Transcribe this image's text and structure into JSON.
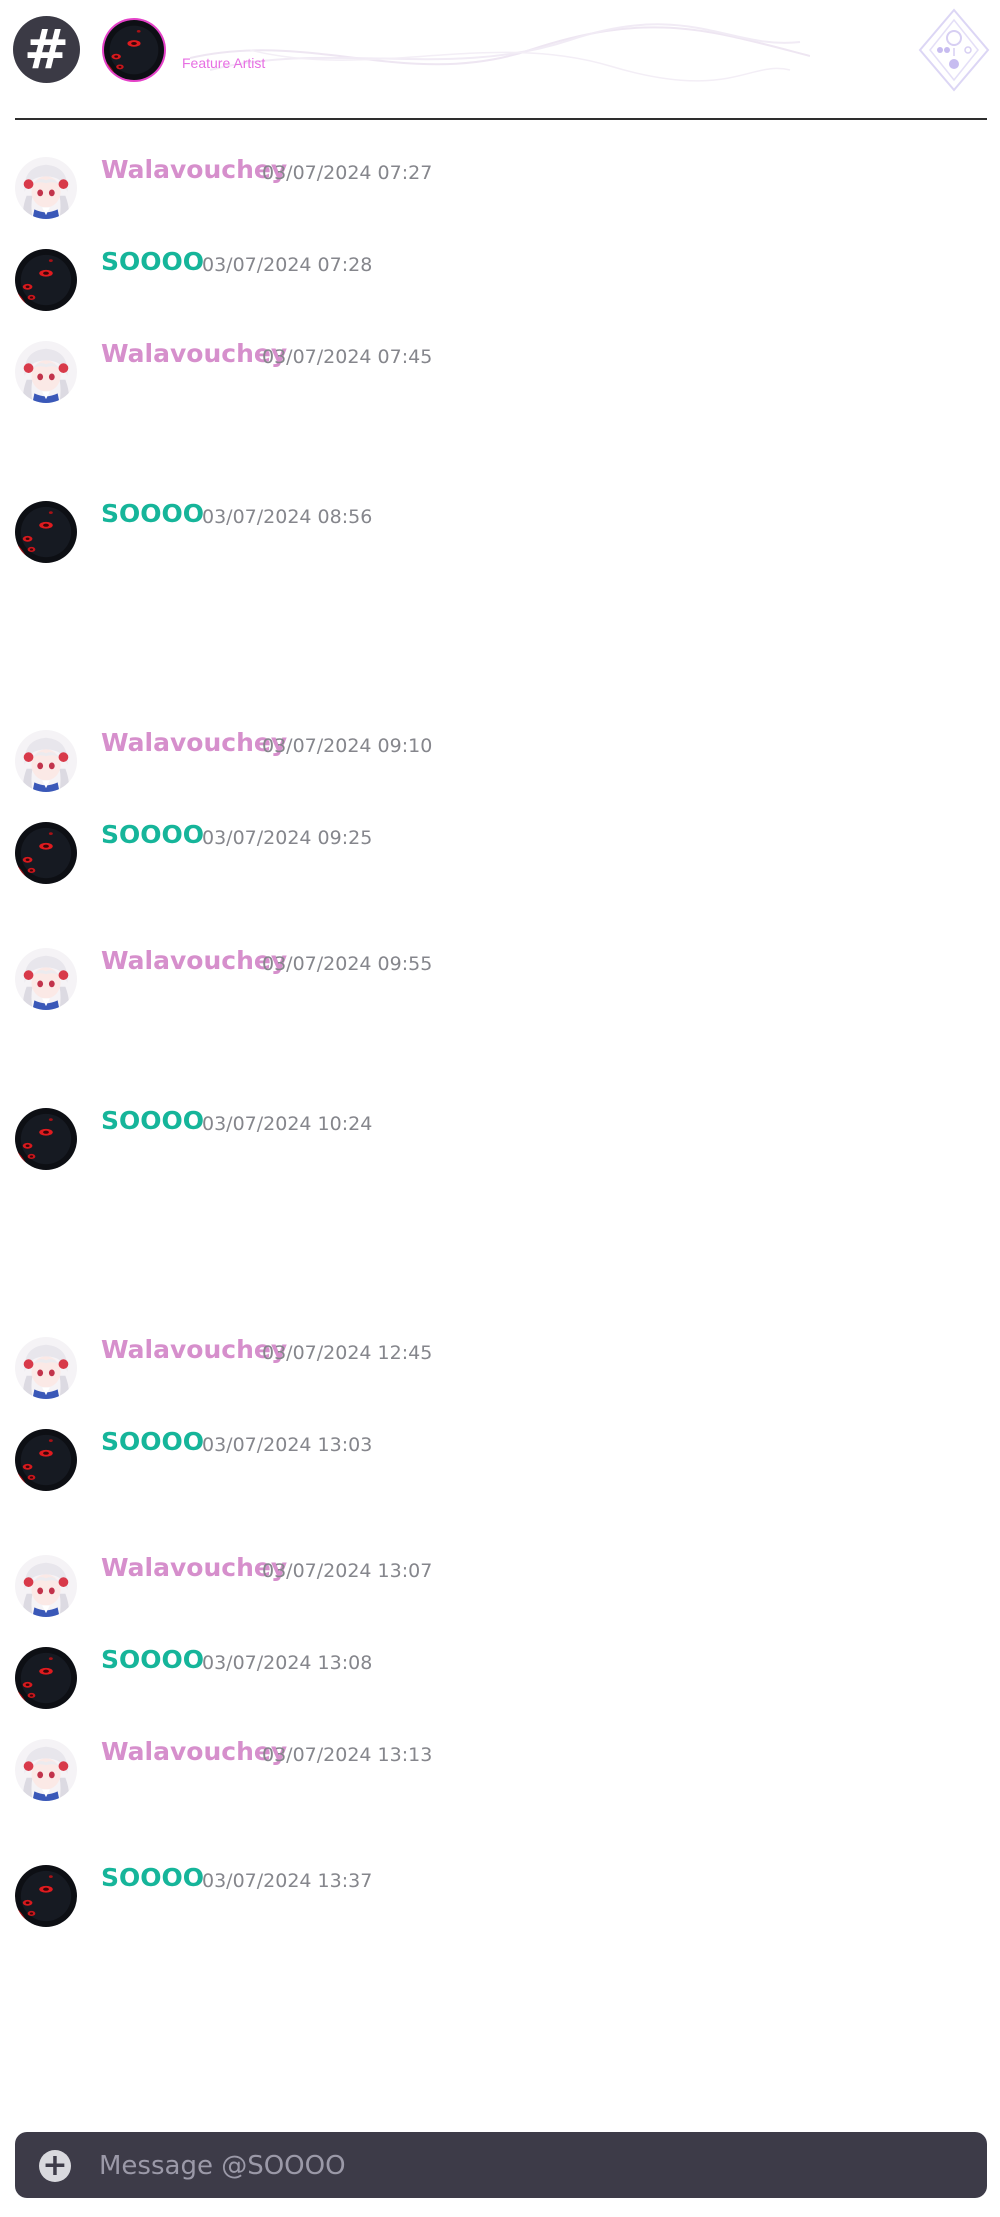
{
  "header": {
    "channel_icon": "hash-icon",
    "role_label": "Feature Artist",
    "emblem_icon": "diamond-emblem-icon"
  },
  "messages": [
    {
      "author": "Walavouchey",
      "timestamp": "03/07/2024 07:27"
    },
    {
      "author": "SOOOO",
      "timestamp": "03/07/2024 07:28"
    },
    {
      "author": "Walavouchey",
      "timestamp": "03/07/2024 07:45"
    },
    {
      "author": "SOOOO",
      "timestamp": "03/07/2024 08:56"
    },
    {
      "author": "Walavouchey",
      "timestamp": "03/07/2024 09:10"
    },
    {
      "author": "SOOOO",
      "timestamp": "03/07/2024 09:25"
    },
    {
      "author": "Walavouchey",
      "timestamp": "03/07/2024 09:55"
    },
    {
      "author": "SOOOO",
      "timestamp": "03/07/2024 10:24"
    },
    {
      "author": "Walavouchey",
      "timestamp": "03/07/2024 12:45"
    },
    {
      "author": "SOOOO",
      "timestamp": "03/07/2024 13:03"
    },
    {
      "author": "Walavouchey",
      "timestamp": "03/07/2024 13:07"
    },
    {
      "author": "SOOOO",
      "timestamp": "03/07/2024 13:08"
    },
    {
      "author": "Walavouchey",
      "timestamp": "03/07/2024 13:13"
    },
    {
      "author": "SOOOO",
      "timestamp": "03/07/2024 13:37"
    }
  ],
  "composer": {
    "placeholder": "Message @SOOOO",
    "add_icon": "plus-circle-icon"
  },
  "colors": {
    "walavouchey_name": "#d68fcc",
    "soooo_name": "#16b59a",
    "timestamp": "#85868c",
    "role_label": "#e76fe3",
    "composer_bg": "#3d3b48"
  }
}
